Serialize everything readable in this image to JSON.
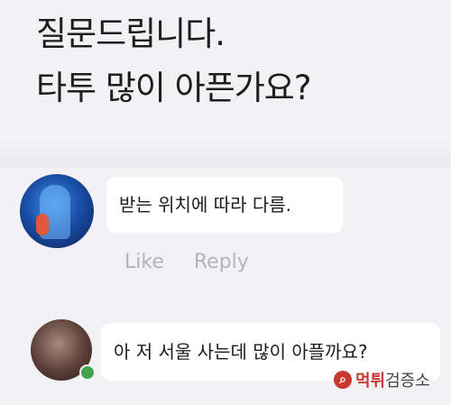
{
  "post": {
    "line1": "질문드립니다.",
    "line2": "타투 많이 아픈가요?"
  },
  "comments": [
    {
      "text": "받는 위치에 따라 다름.",
      "avatar": "throat-xray-avatar"
    },
    {
      "text": "아 저 서울 사는데 많이 아플까요?",
      "avatar": "user-photo-avatar",
      "online": true
    }
  ],
  "actions": {
    "like": "Like",
    "reply": "Reply"
  },
  "watermark": {
    "brand": "먹튀",
    "suffix": "검증소",
    "icon": "magnifier-icon"
  }
}
